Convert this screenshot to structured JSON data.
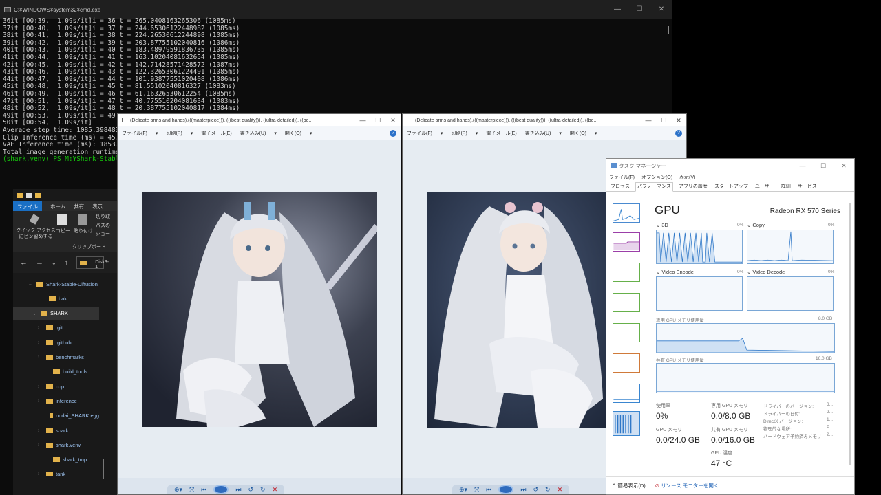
{
  "cmd": {
    "title": "C:¥WINDOWS¥system32¥cmd.exe",
    "lines": [
      "36it [00:39,  1.09s/it]i = 36 t = 265.0408163265306 (1085ms)",
      "37it [00:40,  1.09s/it]i = 37 t = 244.65306122448982 (1085ms)",
      "38it [00:41,  1.09s/it]i = 38 t = 224.26530612244898 (1085ms)",
      "39it [00:42,  1.09s/it]i = 39 t = 203.87755102040816 (1086ms)",
      "40it [00:43,  1.09s/it]i = 40 t = 183.48979591836735 (1085ms)",
      "41it [00:44,  1.09s/it]i = 41 t = 163.10204081632654 (1085ms)",
      "42it [00:45,  1.09s/it]i = 42 t = 142.71428571428572 (1087ms)",
      "43it [00:46,  1.09s/it]i = 43 t = 122.32653061224491 (1085ms)",
      "44it [00:47,  1.09s/it]i = 44 t = 101.93877551020408 (1086ms)",
      "45it [00:48,  1.09s/it]i = 45 t = 81.55102040816327 (1083ms)",
      "46it [00:49,  1.09s/it]i = 46 t = 61.16326530612254 (1085ms)",
      "47it [00:51,  1.09s/it]i = 47 t = 40.775510204081634 (1083ms)",
      "48it [00:52,  1.09s/it]i = 48 t = 20.387755102040817 (1084ms)",
      "49it [00:53,  1.09s/it]i = 49 t",
      "50it [00:54,  1.09s/it]",
      "Average step time: 1085.3984832",
      "Clip Inference time (ms) = 45.0",
      "VAE Inference time (ms): 1853.1",
      "Total image generation runtime"
    ],
    "prompt": "(shark.venv) PS M:¥Shark-Stable"
  },
  "explorer": {
    "tabs": [
      "ファイル",
      "ホーム",
      "共有",
      "表示"
    ],
    "ribbon": {
      "quick_access": "クイック アクセス",
      "pin": "にピン留めする",
      "copy": "コピー",
      "paste": "貼り付け",
      "cut": "切り取",
      "path": "パスの",
      "shortcut": "ショー",
      "group": "クリップボード"
    },
    "address": "Disk3-1",
    "tree": [
      {
        "label": "Shark-Stable-Diffusion",
        "expanded": true
      },
      {
        "label": "bak"
      },
      {
        "label": "SHARK",
        "expanded": true
      },
      {
        "label": ".git"
      },
      {
        "label": ".github"
      },
      {
        "label": "benchmarks"
      },
      {
        "label": "build_tools"
      },
      {
        "label": "cpp"
      },
      {
        "label": "inference"
      },
      {
        "label": "nodai_SHARK.egg"
      },
      {
        "label": "shark"
      },
      {
        "label": "shark.venv"
      },
      {
        "label": "shark_tmp"
      },
      {
        "label": "tank"
      }
    ]
  },
  "viewer1": {
    "title": "(Delicate arms and hands),(((masterpiece))), (((best quality))), ((ultra-detailed)), ((be...",
    "menu": [
      "ファイル(F)",
      "印刷(P)",
      "電子メール(E)",
      "書き込み(U)",
      "開く(O)"
    ]
  },
  "viewer2": {
    "title": "(Delicate arms and hands),(((masterpiece))), (((best quality))), ((ultra-detailed)), ((be...",
    "menu": [
      "ファイル(F)",
      "印刷(P)",
      "電子メール(E)",
      "書き込み(U)",
      "開く(O)"
    ]
  },
  "taskmgr": {
    "title": "タスク マネージャー",
    "menu": [
      "ファイル(F)",
      "オプション(O)",
      "表示(V)"
    ],
    "tabs": [
      "プロセス",
      "パフォーマンス",
      "アプリの履歴",
      "スタートアップ",
      "ユーザー",
      "詳細",
      "サービス"
    ],
    "gpu_title": "GPU",
    "gpu_name": "Radeon RX 570 Series",
    "graphs": {
      "g3d": {
        "label": "3D",
        "pct": "0%"
      },
      "copy": {
        "label": "Copy",
        "pct": "0%"
      },
      "encode": {
        "label": "Video Encode",
        "pct": "0%"
      },
      "decode": {
        "label": "Video Decode",
        "pct": "0%"
      },
      "dedicated": {
        "label": "専用 GPU メモリ使用量",
        "max": "8.0 GB"
      },
      "shared": {
        "label": "共有 GPU メモリ使用量",
        "max": "16.0 GB"
      }
    },
    "stats": {
      "usage_label": "使用率",
      "usage": "0%",
      "ded_label": "専用 GPU メモリ",
      "ded": "0.0/8.0 GB",
      "gpumem_label": "GPU メモリ",
      "gpumem": "0.0/24.0 GB",
      "shared_label": "共有 GPU メモリ",
      "shared": "0.0/16.0 GB",
      "temp_label": "GPU 温度",
      "temp": "47 °C"
    },
    "driver": [
      {
        "k": "ドライバーのバージョン:",
        "v": "3..."
      },
      {
        "k": "ドライバーの日付:",
        "v": "2..."
      },
      {
        "k": "DirectX バージョン:",
        "v": "1..."
      },
      {
        "k": "物理的な場所:",
        "v": "P..."
      },
      {
        "k": "ハードウェア予約済みメモリ:",
        "v": "2..."
      }
    ],
    "footer": {
      "simple": "簡易表示(D)",
      "monitor": "リソース モニターを開く"
    }
  }
}
